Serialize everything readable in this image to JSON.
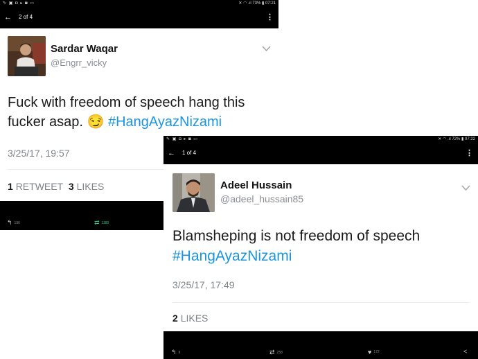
{
  "screenshot1": {
    "status_left_icons": "✎ ▣ ◘ ▸ ◙ ▭",
    "status_right": "✕ ◠ .ıl 73% ▮ 07:21",
    "nav_title": "2 of 4",
    "user": {
      "name": "Sardar Waqar",
      "handle": "@Engrr_vicky"
    },
    "tweet_text": "Fuck with freedom of speech hang this fucker asap. 😏 ",
    "hashtag": "#HangAyazNizami",
    "date": "3/25/17, 19:57",
    "retweets_count": "1",
    "retweets_label": "RETWEET",
    "likes_count": "3",
    "likes_label": "LIKES",
    "actions": {
      "reply_count": "196",
      "retweet_count": "1180"
    },
    "retweet_active_color": "#19cf86",
    "icons": [
      "back-arrow-icon",
      "overflow-menu-icon",
      "chevron-down-icon",
      "reply-icon",
      "retweet-icon"
    ]
  },
  "screenshot2": {
    "status_left_icons": "✎ ▣ ◘ ▸ ◙ ▭",
    "status_right": "✕ ◠ .ıl 72% ▮ 07:22",
    "nav_title": "1 of 4",
    "user": {
      "name": "Adeel Hussain",
      "handle": "@adeel_hussain85"
    },
    "tweet_text": "Blamsheping is not freedom of speech ",
    "hashtag": "#HangAyazNizami",
    "date": "3/25/17, 17:49",
    "likes_count": "2",
    "likes_label": "LIKES",
    "actions": {
      "reply_count": "9",
      "retweet_count": "258",
      "like_count": "172"
    },
    "icons": [
      "back-arrow-icon",
      "overflow-menu-icon",
      "chevron-down-icon",
      "reply-icon",
      "retweet-icon",
      "heart-icon",
      "share-icon"
    ]
  },
  "colors": {
    "hashtag": "#1b95e0",
    "bar_background": "#000000"
  }
}
